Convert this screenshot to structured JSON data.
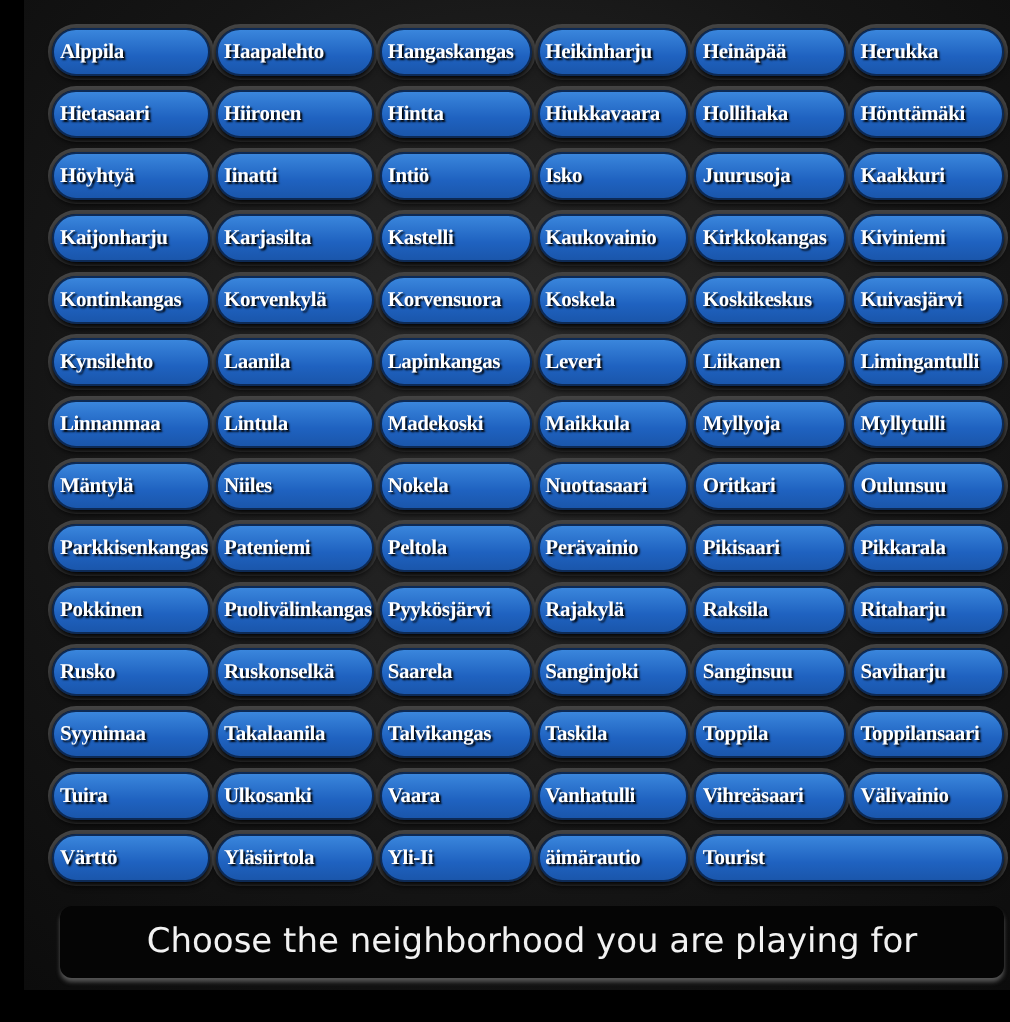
{
  "neighborhoods": [
    {
      "name": "Alppila",
      "kind": "initial"
    },
    {
      "name": "Haapalehto",
      "kind": "initial"
    },
    {
      "name": "Hangaskangas",
      "kind": "plain"
    },
    {
      "name": "Heikinharju",
      "kind": "plain"
    },
    {
      "name": "Heinäpää",
      "kind": "plain"
    },
    {
      "name": "Herukka",
      "kind": "plain"
    },
    {
      "name": "Hietasaari",
      "kind": "plain"
    },
    {
      "name": "Hiironen",
      "kind": "plain"
    },
    {
      "name": "Hintta",
      "kind": "plain"
    },
    {
      "name": "Hiukkavaara",
      "kind": "plain"
    },
    {
      "name": "Hollihaka",
      "kind": "plain"
    },
    {
      "name": "Hönttämäki",
      "kind": "plain"
    },
    {
      "name": "Höyhtyä",
      "kind": "plain"
    },
    {
      "name": "Iinatti",
      "kind": "initial"
    },
    {
      "name": "Intiö",
      "kind": "plain"
    },
    {
      "name": "Isko",
      "kind": "plain"
    },
    {
      "name": "Juurusoja",
      "kind": "initial"
    },
    {
      "name": "Kaakkuri",
      "kind": "initial"
    },
    {
      "name": "Kaijonharju",
      "kind": "plain"
    },
    {
      "name": "Karjasilta",
      "kind": "plain"
    },
    {
      "name": "Kastelli",
      "kind": "plain"
    },
    {
      "name": "Kaukovainio",
      "kind": "plain"
    },
    {
      "name": "Kirkkokangas",
      "kind": "plain"
    },
    {
      "name": "Kiviniemi",
      "kind": "plain"
    },
    {
      "name": "Kontinkangas",
      "kind": "plain"
    },
    {
      "name": "Korvenkylä",
      "kind": "plain"
    },
    {
      "name": "Korvensuora",
      "kind": "plain"
    },
    {
      "name": "Koskela",
      "kind": "plain"
    },
    {
      "name": "Koskikeskus",
      "kind": "plain"
    },
    {
      "name": "Kuivasjärvi",
      "kind": "plain"
    },
    {
      "name": "Kynsilehto",
      "kind": "plain"
    },
    {
      "name": "Laanila",
      "kind": "initial"
    },
    {
      "name": "Lapinkangas",
      "kind": "plain"
    },
    {
      "name": "Leveri",
      "kind": "plain"
    },
    {
      "name": "Liikanen",
      "kind": "plain"
    },
    {
      "name": "Limingantulli",
      "kind": "plain"
    },
    {
      "name": "Linnanmaa",
      "kind": "plain"
    },
    {
      "name": "Lintula",
      "kind": "plain"
    },
    {
      "name": "Madekoski",
      "kind": "initial"
    },
    {
      "name": "Maikkula",
      "kind": "plain"
    },
    {
      "name": "Myllyoja",
      "kind": "plain"
    },
    {
      "name": "Myllytulli",
      "kind": "plain"
    },
    {
      "name": "Mäntylä",
      "kind": "plain"
    },
    {
      "name": "Niiles",
      "kind": "initial"
    },
    {
      "name": "Nokela",
      "kind": "plain"
    },
    {
      "name": "Nuottasaari",
      "kind": "plain"
    },
    {
      "name": "Oritkari",
      "kind": "initial"
    },
    {
      "name": "Oulunsuu",
      "kind": "plain"
    },
    {
      "name": "Parkkisenkangas",
      "kind": "initial"
    },
    {
      "name": "Pateniemi",
      "kind": "plain"
    },
    {
      "name": "Peltola",
      "kind": "plain"
    },
    {
      "name": "Perävainio",
      "kind": "plain"
    },
    {
      "name": "Pikisaari",
      "kind": "plain"
    },
    {
      "name": "Pikkarala",
      "kind": "plain"
    },
    {
      "name": "Pokkinen",
      "kind": "plain"
    },
    {
      "name": "Puolivälinkangas",
      "kind": "plain"
    },
    {
      "name": "Pyykösjärvi",
      "kind": "plain"
    },
    {
      "name": "Rajakylä",
      "kind": "initial"
    },
    {
      "name": "Raksila",
      "kind": "plain"
    },
    {
      "name": "Ritaharju",
      "kind": "plain"
    },
    {
      "name": "Rusko",
      "kind": "plain"
    },
    {
      "name": "Ruskonselkä",
      "kind": "plain"
    },
    {
      "name": "Saarela",
      "kind": "initial"
    },
    {
      "name": "Sanginjoki",
      "kind": "plain"
    },
    {
      "name": "Sanginsuu",
      "kind": "plain"
    },
    {
      "name": "Saviharju",
      "kind": "plain"
    },
    {
      "name": "Syynimaa",
      "kind": "plain"
    },
    {
      "name": "Takalaanila",
      "kind": "initial"
    },
    {
      "name": "Talvikangas",
      "kind": "plain"
    },
    {
      "name": "Taskila",
      "kind": "plain"
    },
    {
      "name": "Toppila",
      "kind": "plain"
    },
    {
      "name": "Toppilansaari",
      "kind": "plain"
    },
    {
      "name": "Tuira",
      "kind": "plain"
    },
    {
      "name": "Ulkosanki",
      "kind": "initial"
    },
    {
      "name": "Vaara",
      "kind": "initial"
    },
    {
      "name": "Vanhatulli",
      "kind": "plain"
    },
    {
      "name": "Vihreäsaari",
      "kind": "plain"
    },
    {
      "name": "Välivainio",
      "kind": "plain"
    },
    {
      "name": "Värttö",
      "kind": "plain"
    },
    {
      "name": "Yläsiirtola",
      "kind": "initial"
    },
    {
      "name": "Yli-Ii",
      "kind": "plain"
    },
    {
      "name": "äimärautio",
      "kind": "initial"
    },
    {
      "name": "Tourist",
      "kind": "wide"
    }
  ],
  "prompt": "Choose the neighborhood you are playing for"
}
